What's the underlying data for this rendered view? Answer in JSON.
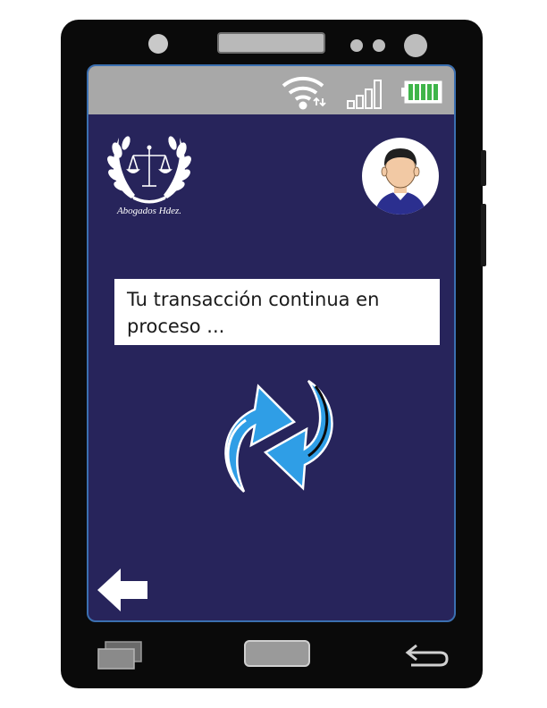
{
  "app": {
    "logo_text": "Abogados Hdez."
  },
  "message": {
    "text": "Tu transacción continua en proceso ..."
  },
  "status": {
    "battery_color": "#3fb54a"
  },
  "colors": {
    "screen_bg": "#27245b",
    "accent": "#2f9ee6"
  },
  "icons": {
    "sync": "sync-arrows-icon",
    "back": "arrow-left-icon",
    "recent": "recent-apps-icon",
    "home": "home-button-icon",
    "nav_back": "return-icon"
  }
}
